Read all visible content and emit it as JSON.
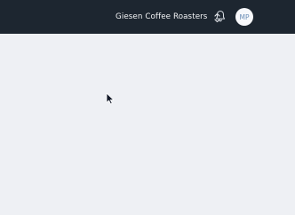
{
  "header": {
    "organization_name": "Giesen Coffee Roasters",
    "org_switcher_icon": "chevron-up-down-icon",
    "notification_icon": "bell-icon",
    "avatar_initials": "MP"
  },
  "colors": {
    "topbar_background": "#1d2630",
    "page_background": "#eef0f4",
    "avatar_background": "#f7f8fb",
    "avatar_text": "#6d8fb8"
  },
  "pointer": {
    "icon": "mouse-cursor-icon"
  }
}
